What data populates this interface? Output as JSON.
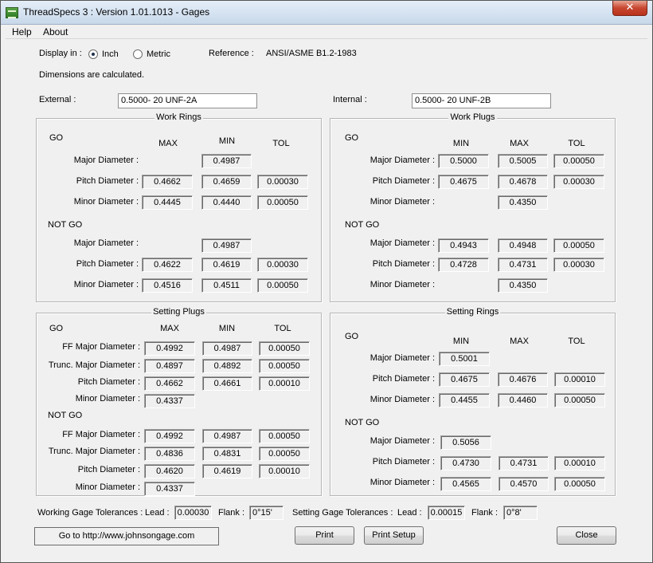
{
  "window": {
    "title": "ThreadSpecs 3 : Version 1.01.1013 - Gages",
    "close_glyph": "✕"
  },
  "menu": {
    "items": [
      "Help",
      "About"
    ]
  },
  "display": {
    "label": "Display in :",
    "inch_label": "Inch",
    "metric_label": "Metric",
    "selected": "Inch",
    "reference_label": "Reference :",
    "reference_value": "ANSI/ASME B1.2-1983"
  },
  "note": "Dimensions are calculated.",
  "external": {
    "label": "External :",
    "value": "0.5000- 20 UNF-2A"
  },
  "internal": {
    "label": "Internal :",
    "value": "0.5000- 20 UNF-2B"
  },
  "work_rings": {
    "title": "Work Rings",
    "go_label": "GO",
    "notgo_label": "NOT GO",
    "headers": [
      "MAX",
      "MIN",
      "TOL"
    ],
    "go": {
      "major_label": "Major Diameter :",
      "major": [
        "",
        "0.4987",
        ""
      ],
      "pitch_label": "Pitch Diameter :",
      "pitch": [
        "0.4662",
        "0.4659",
        "0.00030"
      ],
      "minor_label": "Minor Diameter :",
      "minor": [
        "0.4445",
        "0.4440",
        "0.00050"
      ]
    },
    "notgo": {
      "major_label": "Major Diameter :",
      "major": [
        "",
        "0.4987",
        ""
      ],
      "pitch_label": "Pitch Diameter :",
      "pitch": [
        "0.4622",
        "0.4619",
        "0.00030"
      ],
      "minor_label": "Minor Diameter :",
      "minor": [
        "0.4516",
        "0.4511",
        "0.00050"
      ]
    }
  },
  "work_plugs": {
    "title": "Work Plugs",
    "go_label": "GO",
    "notgo_label": "NOT GO",
    "headers": [
      "MIN",
      "MAX",
      "TOL"
    ],
    "go": {
      "major_label": "Major Diameter :",
      "major": [
        "0.5000",
        "0.5005",
        "0.00050"
      ],
      "pitch_label": "Pitch Diameter :",
      "pitch": [
        "0.4675",
        "0.4678",
        "0.00030"
      ],
      "minor_label": "Minor Diameter :",
      "minor": [
        "",
        "0.4350",
        ""
      ]
    },
    "notgo": {
      "major_label": "Major Diameter :",
      "major": [
        "0.4943",
        "0.4948",
        "0.00050"
      ],
      "pitch_label": "Pitch Diameter :",
      "pitch": [
        "0.4728",
        "0.4731",
        "0.00030"
      ],
      "minor_label": "Minor Diameter :",
      "minor": [
        "",
        "0.4350",
        ""
      ]
    }
  },
  "setting_plugs": {
    "title": "Setting Plugs",
    "go_label": "GO",
    "notgo_label": "NOT GO",
    "headers": [
      "MAX",
      "MIN",
      "TOL"
    ],
    "go": {
      "ff_label": "FF Major Diameter :",
      "ff": [
        "0.4992",
        "0.4987",
        "0.00050"
      ],
      "trunc_label": "Trunc. Major Diameter :",
      "trunc": [
        "0.4897",
        "0.4892",
        "0.00050"
      ],
      "pitch_label": "Pitch Diameter :",
      "pitch": [
        "0.4662",
        "0.4661",
        "0.00010"
      ],
      "minor_label": "Minor Diameter :",
      "minor": [
        "0.4337",
        "",
        ""
      ]
    },
    "notgo": {
      "ff_label": "FF Major Diameter :",
      "ff": [
        "0.4992",
        "0.4987",
        "0.00050"
      ],
      "trunc_label": "Trunc. Major Diameter :",
      "trunc": [
        "0.4836",
        "0.4831",
        "0.00050"
      ],
      "pitch_label": "Pitch Diameter :",
      "pitch": [
        "0.4620",
        "0.4619",
        "0.00010"
      ],
      "minor_label": "Minor Diameter :",
      "minor": [
        "0.4337",
        "",
        ""
      ]
    }
  },
  "setting_rings": {
    "title": "Setting Rings",
    "go_label": "GO",
    "notgo_label": "NOT GO",
    "headers": [
      "MIN",
      "MAX",
      "TOL"
    ],
    "go": {
      "major_label": "Major Diameter :",
      "major": [
        "0.5001",
        "",
        ""
      ],
      "pitch_label": "Pitch Diameter :",
      "pitch": [
        "0.4675",
        "0.4676",
        "0.00010"
      ],
      "minor_label": "Minor Diameter :",
      "minor": [
        "0.4455",
        "0.4460",
        "0.00050"
      ]
    },
    "notgo": {
      "major_label": "Major Diameter :",
      "major": [
        "0.5056",
        "",
        ""
      ],
      "pitch_label": "Pitch Diameter :",
      "pitch": [
        "0.4730",
        "0.4731",
        "0.00010"
      ],
      "minor_label": "Minor Diameter :",
      "minor": [
        "0.4565",
        "0.4570",
        "0.00050"
      ]
    }
  },
  "tolerances": {
    "working_label": "Working Gage Tolerances :",
    "lead_label": "Lead :",
    "flank_label": "Flank :",
    "working_lead": "0.00030",
    "working_flank": "0°15'",
    "setting_label": "Setting Gage Tolerances :",
    "setting_lead": "0.00015",
    "setting_flank": "0°8'"
  },
  "buttons": {
    "website": "Go to http://www.johnsongage.com",
    "print": "Print",
    "print_setup": "Print Setup",
    "close": "Close"
  }
}
